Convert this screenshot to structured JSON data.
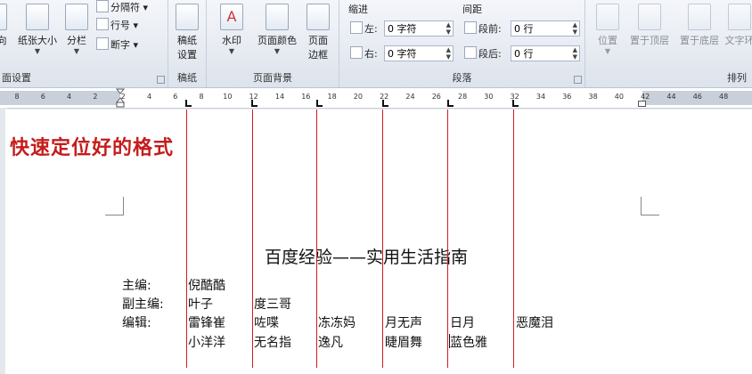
{
  "ribbon": {
    "groups": {
      "page_setup": {
        "label": "面设置",
        "btn_partial": "向",
        "size": "纸张大小",
        "columns": "分栏",
        "breaks": "分隔符",
        "line_numbers": "行号",
        "hyphenation": "断字"
      },
      "manuscript": {
        "label": "稿纸",
        "btn": "稿纸\n设置"
      },
      "page_background": {
        "label": "页面背景",
        "watermark": "水印",
        "page_color": "页面颜色",
        "page_border": "页面\n边框"
      },
      "paragraph": {
        "label": "段落",
        "indent_title": "缩进",
        "spacing_title": "间距",
        "left_label": "左:",
        "right_label": "右:",
        "before_label": "段前:",
        "after_label": "段后:",
        "left_value": "0 字符",
        "right_value": "0 字符",
        "before_value": "0 行",
        "after_value": "0 行"
      },
      "arrange": {
        "label": "排列",
        "position": "位置",
        "bring_front": "置于顶层",
        "send_back": "置于底层",
        "wrap": "文字环"
      }
    }
  },
  "ruler": {
    "ticks": [
      "8",
      "6",
      "4",
      "2",
      "2",
      "4",
      "6",
      "8",
      "10",
      "12",
      "14",
      "16",
      "18",
      "20",
      "22",
      "24",
      "26",
      "28",
      "30",
      "32",
      "34",
      "36",
      "38",
      "40",
      "42",
      "44",
      "46",
      "48"
    ]
  },
  "document": {
    "annotation": "快速定位好的格式",
    "title": "百度经验——实用生活指南",
    "rows": [
      {
        "label": "主编:",
        "cells": [
          "倪酷酷"
        ]
      },
      {
        "label": "副主编:",
        "cells": [
          "叶子",
          "度三哥"
        ]
      },
      {
        "label": "编辑:",
        "cells": [
          "雷锋崔",
          "咗喋",
          "冻冻妈",
          "月无声",
          "日月",
          "恶魔泪"
        ]
      },
      {
        "label": "",
        "cells": [
          "小洋洋",
          "无名指",
          "逸凡",
          "睫眉舞",
          "蓝色雅"
        ]
      }
    ]
  },
  "colors": {
    "guide_line": "#d31b1b",
    "annotation": "#c51c1c"
  }
}
